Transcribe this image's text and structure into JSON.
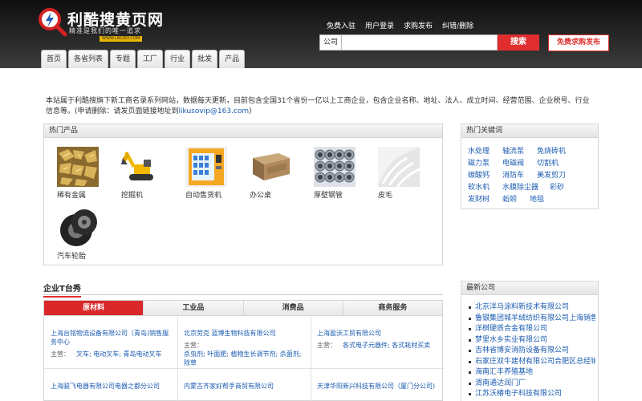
{
  "header": {
    "logo_text": "利酷搜黄页网",
    "slogan": "精准是我们的唯一追求",
    "logo_url": "WWW.LIKUSO.COM",
    "top_links": [
      "免费入驻",
      "用户登录",
      "求购发布",
      "纠错/删除"
    ],
    "search_type": "公司",
    "search_value": "",
    "search_button": "搜索",
    "post_button": "免费求购发布",
    "nav_tabs": [
      "首页",
      "各省列表",
      "专题",
      "工厂",
      "行业",
      "批发",
      "产品"
    ]
  },
  "intro": {
    "text": "本站属于利酷搜旗下新工商名录系列网站，数据每天更新，目前包含全国31个省份一亿以上工商企业，包含企业名称、地址、法人、成立时间、经营范围、企业税号、行业信息等。(申请删除：请发页面链接地址到",
    "email": "likusovip@163.com",
    "tail": ")"
  },
  "hot_products": {
    "title": "热门产品",
    "items": [
      {
        "label": "稀有金属",
        "icon": "metal-scrap-icon"
      },
      {
        "label": "挖掘机",
        "icon": "excavator-icon"
      },
      {
        "label": "自动售货机",
        "icon": "vending-machine-icon"
      },
      {
        "label": "办公桌",
        "icon": "office-desk-icon"
      },
      {
        "label": "厚壁钢管",
        "icon": "steel-pipes-icon"
      },
      {
        "label": "皮毛",
        "icon": "fur-icon"
      },
      {
        "label": "汽车轮胎",
        "icon": "tires-icon"
      }
    ]
  },
  "hot_keywords": {
    "title": "热门关键词",
    "items": [
      "水处理",
      "轴流泵",
      "免烧砖机",
      "磁力泵",
      "电磁阀",
      "切割机",
      "碳酸钙",
      "消防车",
      "美发剪刀",
      "软水机",
      "水膜除尘器",
      "彩砂",
      "发财树",
      "蚯蚓",
      "地毯"
    ]
  },
  "showcase": {
    "title": "企业T台秀",
    "tabs": [
      "原材料",
      "工业品",
      "消费品",
      "商务服务"
    ],
    "main_label": "主营：",
    "companies": [
      {
        "name": "上海台铭物流设备有限公司（青岛)销售服务中心",
        "main": "叉车; 电动叉车; 青岛电动叉车"
      },
      {
        "name": "北京劳克 蓝博生物科技有限公司",
        "main": "杀虫剂; 叶面肥; 植物生长调节剂; 杀菌剂; 除草"
      },
      {
        "name": "上海盈沃工贸有限公司",
        "main": "各式电子元器件; 各式耗材买卖"
      },
      {
        "name": "上海骏飞电器有限公司电器之都分公司",
        "main": ""
      },
      {
        "name": "内蒙古齐家好帮手商贸有限公司",
        "main": ""
      },
      {
        "name": "天津华阳新兴科技有限公司（厦门分公司)",
        "main": ""
      }
    ]
  },
  "latest_companies": {
    "title": "最新公司",
    "items": [
      "北京洋马涂料新技术有限公司",
      "鲁银集团城羊绒纺织有限公司上海销售",
      "洋棋硬质合金有限公司",
      "梦里水乡实业有限公司",
      "吉林省博安消防设备有限公司",
      "石家庄双牛建材有限公司合肥区总经销",
      "海南汇丰养殖基地",
      "渭南通达润门厂",
      "江苏沃椿电子科技有限公司"
    ]
  },
  "colors": {
    "accent": "#e02e2e",
    "link": "#1a5bb0",
    "header_bg": "#1e1e1e"
  }
}
